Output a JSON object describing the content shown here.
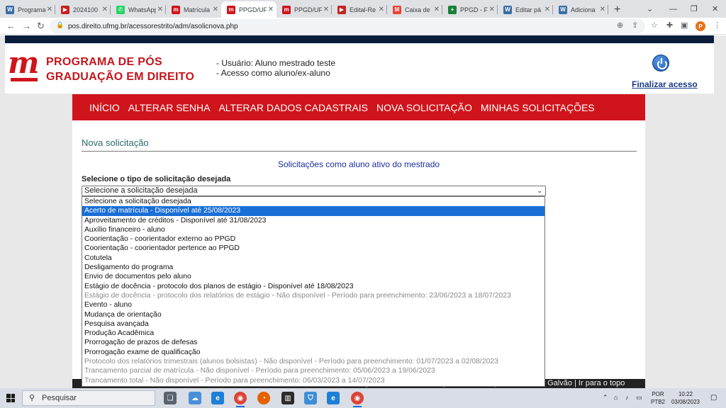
{
  "browser": {
    "tabs": [
      {
        "label": "Programa",
        "favicon": "wordpress-icon",
        "color": "#3a6ea5",
        "glyph": "W"
      },
      {
        "label": "2024100",
        "favicon": "pdf-icon",
        "color": "#c5221f",
        "glyph": "▶"
      },
      {
        "label": "WhatsApp",
        "favicon": "whatsapp-icon",
        "color": "#25d366",
        "glyph": "✆"
      },
      {
        "label": "Matrícula",
        "favicon": "ufmg-m-icon",
        "color": "#d0141b",
        "glyph": "m"
      },
      {
        "label": "PPGD/UF",
        "favicon": "ufmg-m-icon",
        "color": "#d0141b",
        "glyph": "m"
      },
      {
        "label": "PPGD/UF",
        "favicon": "ufmg-m-icon",
        "color": "#d0141b",
        "glyph": "m"
      },
      {
        "label": "Edital-Re",
        "favicon": "pdf-icon",
        "color": "#c5221f",
        "glyph": "▶"
      },
      {
        "label": "Caixa de",
        "favicon": "gmail-icon",
        "color": "#ea4335",
        "glyph": "M"
      },
      {
        "label": "PPGD - F",
        "favicon": "sheets-icon",
        "color": "#188038",
        "glyph": "+"
      },
      {
        "label": "Editar pá",
        "favicon": "wordpress-icon",
        "color": "#3a6ea5",
        "glyph": "W"
      },
      {
        "label": "Adiciona",
        "favicon": "wordpress-icon",
        "color": "#3a6ea5",
        "glyph": "W"
      }
    ],
    "active_tab_index": 4,
    "url": "pos.direito.ufmg.br/acessorestrito/adm/asolicnova.php",
    "profile_initial": "P"
  },
  "header": {
    "title_line1": "PROGRAMA DE PÓS",
    "title_line2": "GRADUAÇÃO EM DIREITO",
    "user_line": "- Usuário: Aluno mestrado teste",
    "access_line": "- Acesso como aluno/ex-aluno",
    "logout_label": "Finalizar acesso"
  },
  "menu": {
    "items": [
      "INÍCIO",
      "ALTERAR SENHA",
      "ALTERAR DADOS CADASTRAIS",
      "NOVA SOLICITAÇÃO",
      "MINHAS SOLICITAÇÕES"
    ]
  },
  "main": {
    "section_title": "Nova solicitação",
    "subheading": "Solicitações como aluno ativo do mestrado",
    "select_label": "Selecione o tipo de solicitação desejada",
    "select_value": "Selecione a solicitação desejada",
    "options": [
      {
        "label": "Selecione a solicitação desejada",
        "state": "normal"
      },
      {
        "label": "Acerto de matrícula - Disponível até 25/08/2023",
        "state": "selected"
      },
      {
        "label": "Aproveitamento de créditos - Disponível até 31/08/2023",
        "state": "normal"
      },
      {
        "label": "Auxílio financeiro - aluno",
        "state": "normal"
      },
      {
        "label": "Coorientação - coorientador externo ao PPGD",
        "state": "normal"
      },
      {
        "label": "Coorientação - coorientador pertence ao PPGD",
        "state": "normal"
      },
      {
        "label": "Cotutela",
        "state": "normal"
      },
      {
        "label": "Desligamento do programa",
        "state": "normal"
      },
      {
        "label": "Envio de documentos pelo aluno",
        "state": "normal"
      },
      {
        "label": "Estágio de docência - protocolo dos planos de estágio - Disponível até 18/08/2023",
        "state": "normal"
      },
      {
        "label": "Estágio de docência - protocolo dos relatórios de estágio - Não disponível - Período para preenchimento: 23/06/2023 a 18/07/2023",
        "state": "disabled"
      },
      {
        "label": "Evento - aluno",
        "state": "normal"
      },
      {
        "label": "Mudança de orientação",
        "state": "normal"
      },
      {
        "label": "Pesquisa avançada",
        "state": "normal"
      },
      {
        "label": "Produção Acadêmica",
        "state": "normal"
      },
      {
        "label": "Prorrogação de prazos de defesas",
        "state": "normal"
      },
      {
        "label": "Prorrogação exame de qualificação",
        "state": "normal"
      },
      {
        "label": "Protocolo dos relatórios trimestrais (alunos bolsistas) - Não disponível - Período para preenchimento: 01/07/2023 a 02/08/2023",
        "state": "disabled"
      },
      {
        "label": "Trancamento parcial de matrícula - Não disponível - Período para preenchimento: 05/06/2023 a 19/06/2023",
        "state": "disabled"
      },
      {
        "label": "Trancamento total - Não disponível - Período para preenchimento: 06/03/2023 a 14/07/2023",
        "state": "disabled"
      }
    ]
  },
  "footer": {
    "text": "© Programa de Pós-Graduação em Direito | Eduardo Paci Galvão | Ir para o topo"
  },
  "taskbar": {
    "search_placeholder": "Pesquisar",
    "lang_top": "POR",
    "lang_bottom": "PTB2",
    "time": "10:22",
    "date": "03/08/2023"
  },
  "colors": {
    "brand_red": "#d0141b",
    "navy": "#0a1e3c",
    "link_blue": "#1a2fa0",
    "selected_option": "#1a6fd6"
  }
}
